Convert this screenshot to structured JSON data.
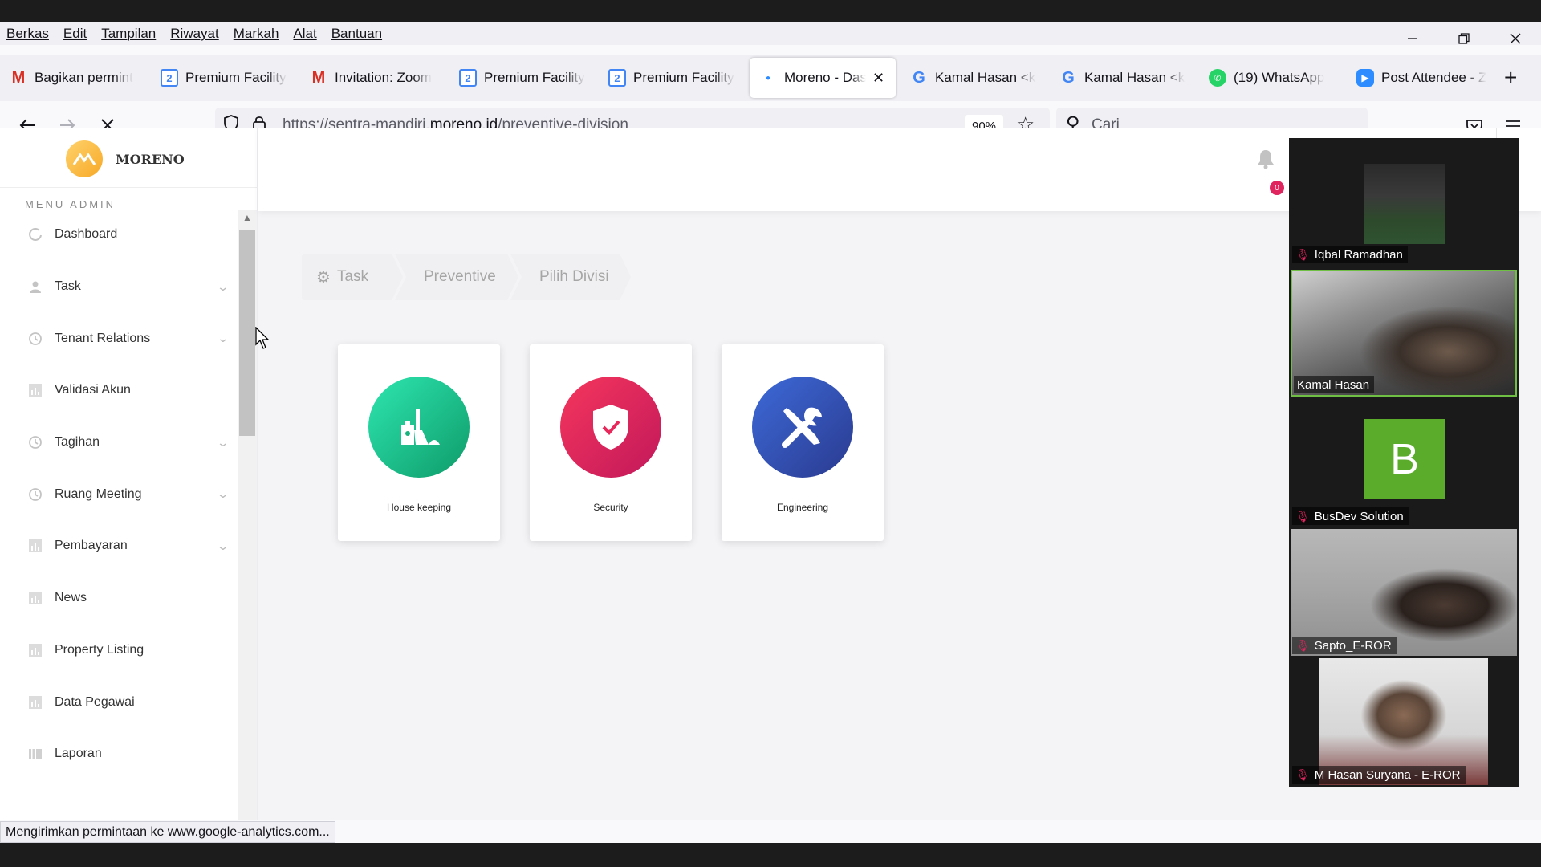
{
  "browser": {
    "menu": [
      "Berkas",
      "Edit",
      "Tampilan",
      "Riwayat",
      "Markah",
      "Alat",
      "Bantuan"
    ],
    "tabs": [
      {
        "label": "Bagikan permint",
        "icon": "gmail-icon"
      },
      {
        "label": "Premium Facility",
        "icon": "calendar-icon"
      },
      {
        "label": "Invitation: Zoom",
        "icon": "gmail-icon"
      },
      {
        "label": "Premium Facility",
        "icon": "calendar-icon"
      },
      {
        "label": "Premium Facility",
        "icon": "calendar-icon"
      },
      {
        "label": "Moreno - Dasl",
        "icon": "moreno-icon",
        "active": true
      },
      {
        "label": "Kamal Hasan <k",
        "icon": "google-icon"
      },
      {
        "label": "Kamal Hasan <k",
        "icon": "google-icon"
      },
      {
        "label": "(19) WhatsApp",
        "icon": "whatsapp-icon"
      },
      {
        "label": "Post Attendee - Z",
        "icon": "zoom-icon"
      }
    ],
    "url_prefix": "https://sentra-mandiri.",
    "url_domain": "moreno.id",
    "url_path": "/preventive-division",
    "zoom": "90%",
    "search_placeholder": "Cari",
    "status_text": "Mengirimkan permintaan ke www.google-analytics.com..."
  },
  "app": {
    "brand_name": "MORENO",
    "menu_heading": "MENU ADMIN",
    "notifications_count": "0",
    "sidebar": [
      {
        "label": "Dashboard",
        "icon": "dashboard-icon",
        "has_submenu": false
      },
      {
        "label": "Task",
        "icon": "user-icon",
        "has_submenu": true
      },
      {
        "label": "Tenant Relations",
        "icon": "clock-icon",
        "has_submenu": true
      },
      {
        "label": "Validasi Akun",
        "icon": "chart-icon",
        "has_submenu": false
      },
      {
        "label": "Tagihan",
        "icon": "clock-icon",
        "has_submenu": true
      },
      {
        "label": "Ruang Meeting",
        "icon": "clock-icon",
        "has_submenu": true
      },
      {
        "label": "Pembayaran",
        "icon": "chart-icon",
        "has_submenu": true
      },
      {
        "label": "News",
        "icon": "chart-icon",
        "has_submenu": false
      },
      {
        "label": "Property Listing",
        "icon": "chart-icon",
        "has_submenu": false
      },
      {
        "label": "Data Pegawai",
        "icon": "chart-icon",
        "has_submenu": false
      },
      {
        "label": "Laporan",
        "icon": "bars-icon",
        "has_submenu": false
      }
    ],
    "breadcrumb": [
      "Task",
      "Preventive",
      "Pilih Divisi"
    ],
    "divisions": [
      {
        "label": "House keeping",
        "icon": "broom-icon",
        "color": "#1bbf8a"
      },
      {
        "label": "Security",
        "icon": "shield-icon",
        "color": "#e8285a"
      },
      {
        "label": "Engineering",
        "icon": "tools-icon",
        "color": "#3550b8"
      }
    ]
  },
  "zoom_panel": {
    "participants": [
      {
        "name": "Iqbal Ramadhan",
        "muted": true
      },
      {
        "name": "Kamal Hasan",
        "muted": false,
        "speaking": true
      },
      {
        "name": "BusDev Solution",
        "muted": true,
        "avatar_letter": "B",
        "avatar_color": "#5cac2c"
      },
      {
        "name": "Sapto_E-ROR",
        "muted": true
      },
      {
        "name": "M Hasan Suryana - E-ROR",
        "muted": true
      }
    ]
  }
}
